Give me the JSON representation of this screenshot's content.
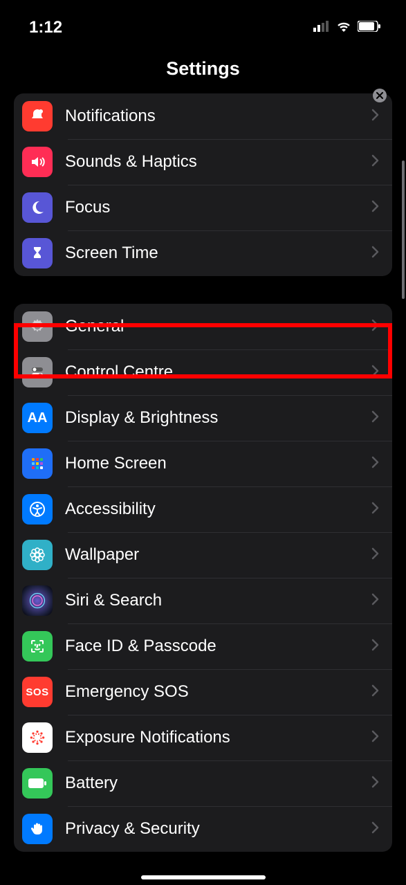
{
  "status": {
    "time": "1:12"
  },
  "header": {
    "title": "Settings"
  },
  "highlight": {
    "target": "general"
  },
  "groups": [
    {
      "rows": [
        {
          "id": "notifications",
          "label": "Notifications",
          "icon": "bell-icon",
          "bg": "bg-red"
        },
        {
          "id": "sounds",
          "label": "Sounds & Haptics",
          "icon": "speaker-icon",
          "bg": "bg-pink"
        },
        {
          "id": "focus",
          "label": "Focus",
          "icon": "moon-icon",
          "bg": "bg-indigo"
        },
        {
          "id": "screentime",
          "label": "Screen Time",
          "icon": "hourglass-icon",
          "bg": "bg-indigo"
        }
      ]
    },
    {
      "rows": [
        {
          "id": "general",
          "label": "General",
          "icon": "gear-icon",
          "bg": "bg-gray"
        },
        {
          "id": "controlcentre",
          "label": "Control Centre",
          "icon": "toggles-icon",
          "bg": "bg-gray2"
        },
        {
          "id": "display",
          "label": "Display & Brightness",
          "icon": "aa-icon",
          "bg": "bg-blue"
        },
        {
          "id": "homescreen",
          "label": "Home Screen",
          "icon": "grid-icon",
          "bg": "bg-blued"
        },
        {
          "id": "accessibility",
          "label": "Accessibility",
          "icon": "person-circle-icon",
          "bg": "bg-blue2"
        },
        {
          "id": "wallpaper",
          "label": "Wallpaper",
          "icon": "flower-icon",
          "bg": "bg-teal"
        },
        {
          "id": "siri",
          "label": "Siri & Search",
          "icon": "siri-icon",
          "bg": "bg-siri"
        },
        {
          "id": "faceid",
          "label": "Face ID & Passcode",
          "icon": "face-icon",
          "bg": "bg-green"
        },
        {
          "id": "sos",
          "label": "Emergency SOS",
          "icon": "sos-icon",
          "bg": "bg-sos"
        },
        {
          "id": "exposure",
          "label": "Exposure Notifications",
          "icon": "virus-icon",
          "bg": "bg-white"
        },
        {
          "id": "battery",
          "label": "Battery",
          "icon": "battery-icon",
          "bg": "bg-green2"
        },
        {
          "id": "privacy",
          "label": "Privacy & Security",
          "icon": "hand-icon",
          "bg": "bg-blue2"
        }
      ]
    }
  ]
}
